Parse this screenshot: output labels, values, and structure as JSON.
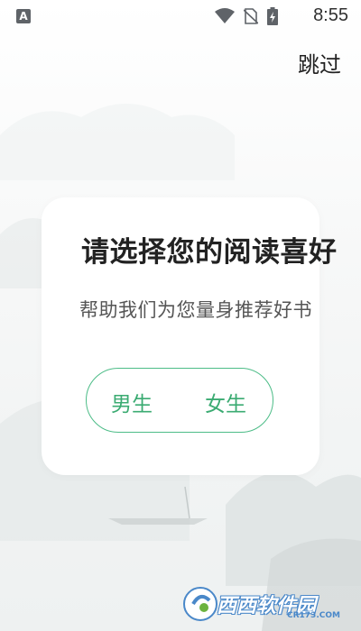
{
  "status_bar": {
    "notification_icon": "A",
    "time": "8:55",
    "icons": [
      "wifi-icon",
      "no-sim-icon",
      "battery-charging-icon"
    ]
  },
  "skip_label": "跳过",
  "dialog": {
    "title": "请选择您的阅读喜好",
    "subtitle": "帮助我们为您量身推荐好书",
    "male_label": "男生",
    "female_label": "女生"
  },
  "watermark": {
    "text": "西西软件园",
    "sub": "CR173.COM"
  },
  "colors": {
    "accent": "#3bab72",
    "accent_border": "#4cbc87",
    "title": "#222222",
    "subtitle": "#555555"
  }
}
